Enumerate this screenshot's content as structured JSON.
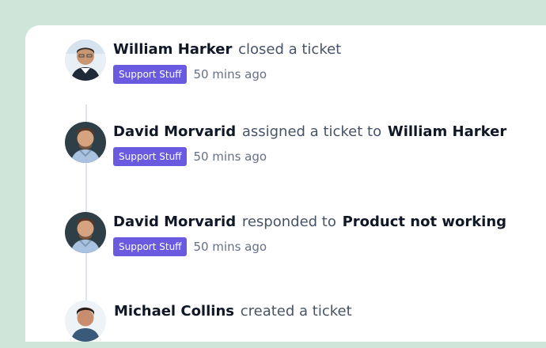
{
  "activity": {
    "items": [
      {
        "actor": "William Harker",
        "action": "closed a ticket",
        "target": "",
        "badge": "Support Stuff",
        "time": "50 mins ago",
        "avatar_icon": "person-avatar"
      },
      {
        "actor": "David Morvarid",
        "action": "assigned a ticket to",
        "target": "William Harker",
        "badge": "Support Stuff",
        "time": "50 mins ago",
        "avatar_icon": "person-avatar"
      },
      {
        "actor": "David Morvarid",
        "action": "responded to",
        "target": "Product not working",
        "badge": "Support Stuff",
        "time": "50 mins ago",
        "avatar_icon": "person-avatar"
      },
      {
        "actor": "Michael Collins",
        "action": "created a ticket",
        "target": "",
        "badge": "",
        "time": "",
        "avatar_icon": "person-avatar"
      }
    ]
  },
  "colors": {
    "background": "#cfe5d9",
    "panel": "#ffffff",
    "badge": "#6a5ae0",
    "primary_text": "#101828",
    "secondary_text": "#475467",
    "timeline": "#dfe3ea"
  }
}
